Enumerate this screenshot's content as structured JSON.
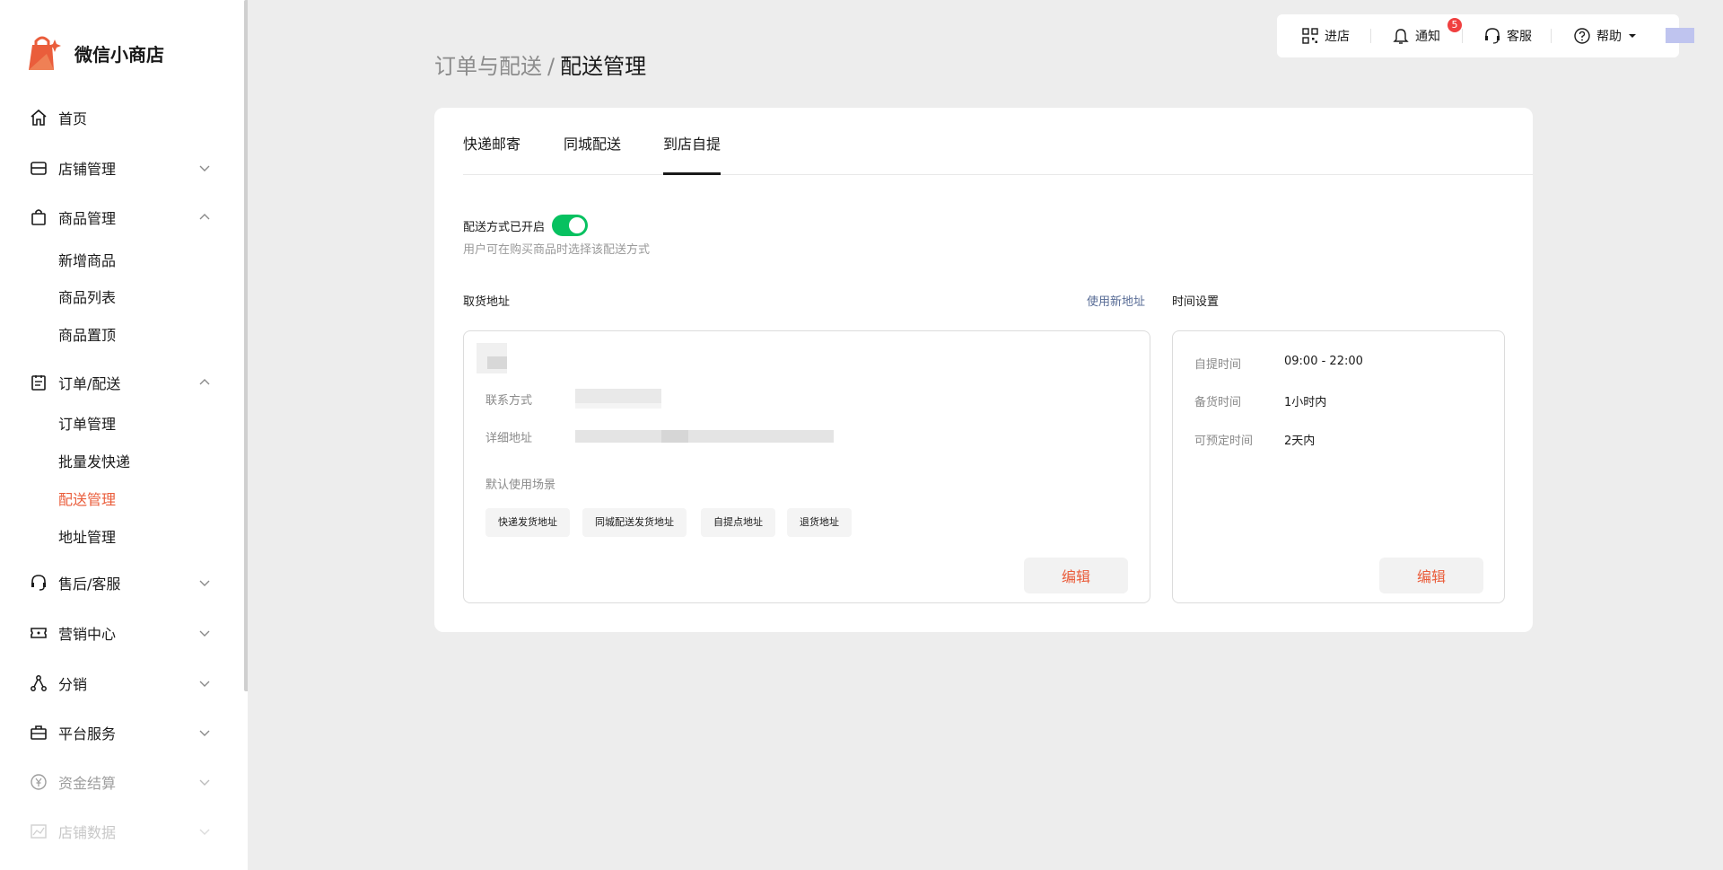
{
  "app": {
    "name": "微信小商店"
  },
  "sidebar": {
    "items": [
      {
        "label": "首页",
        "icon": "home-icon"
      },
      {
        "label": "店铺管理",
        "icon": "store-icon"
      },
      {
        "label": "商品管理",
        "icon": "bag-icon"
      },
      {
        "label": "订单/配送",
        "icon": "clipboard-icon"
      },
      {
        "label": "售后/客服",
        "icon": "headset-icon"
      },
      {
        "label": "营销中心",
        "icon": "ticket-icon"
      },
      {
        "label": "分销",
        "icon": "share-icon"
      },
      {
        "label": "平台服务",
        "icon": "briefcase-icon"
      },
      {
        "label": "资金结算",
        "icon": "yuan-icon"
      },
      {
        "label": "店铺数据",
        "icon": "chart-icon"
      }
    ],
    "goods_sub": [
      "新增商品",
      "商品列表",
      "商品置顶"
    ],
    "order_sub": [
      "订单管理",
      "批量发快递",
      "配送管理",
      "地址管理"
    ],
    "active_sub": "配送管理"
  },
  "topbar": {
    "enter_store": "进店",
    "notify": "通知",
    "notify_count": "5",
    "service": "客服",
    "help": "帮助"
  },
  "breadcrumb": {
    "parent": "订单与配送",
    "separator": "/",
    "current": "配送管理"
  },
  "tabs": [
    "快递邮寄",
    "同城配送",
    "到店自提"
  ],
  "active_tab": "到店自提",
  "delivery": {
    "toggle_label": "配送方式已开启",
    "toggle_on": true,
    "toggle_desc": "用户可在购买商品时选择该配送方式"
  },
  "address": {
    "section_title": "取货地址",
    "new_address_link": "使用新地址",
    "contact_label": "联系方式",
    "detail_label": "详细地址",
    "scenario_label": "默认使用场景",
    "tags": [
      "快递发货地址",
      "同城配送发货地址",
      "自提点地址",
      "退货地址"
    ],
    "edit_label": "编辑"
  },
  "time": {
    "section_title": "时间设置",
    "rows": [
      {
        "label": "自提时间",
        "value": "09:00 - 22:00"
      },
      {
        "label": "备货时间",
        "value": "1小时内"
      },
      {
        "label": "可预定时间",
        "value": "2天内"
      }
    ],
    "edit_label": "编辑"
  },
  "colors": {
    "accent": "#ea5d3b",
    "toggle_on": "#07c160",
    "link": "#576b95",
    "badge": "#f04040"
  }
}
